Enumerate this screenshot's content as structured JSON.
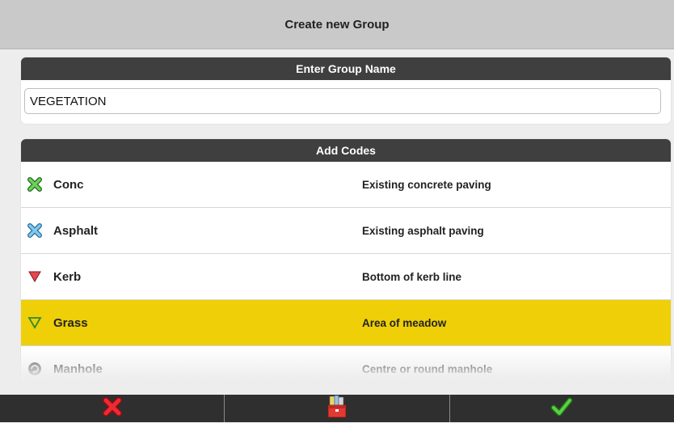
{
  "header": {
    "title": "Create new Group"
  },
  "name_section": {
    "title": "Enter Group Name",
    "value": "VEGETATION"
  },
  "codes_section": {
    "title": "Add Codes",
    "rows": [
      {
        "name": "Conc",
        "description": "Existing concrete paving",
        "icon": "green-x-point-icon",
        "selected": false
      },
      {
        "name": "Asphalt",
        "description": "Existing asphalt paving",
        "icon": "blue-x-point-icon",
        "selected": false
      },
      {
        "name": "Kerb",
        "description": "Bottom of kerb line",
        "icon": "red-triangle-line-icon",
        "selected": false
      },
      {
        "name": "Grass",
        "description": "Area of meadow",
        "icon": "green-triangle-outline-icon",
        "selected": true
      },
      {
        "name": "Manhole",
        "description": "Centre or round manhole",
        "icon": "grey-circle-arrow-icon",
        "selected": false
      }
    ]
  },
  "toolbar": {
    "cancel_icon": "red-x-cancel-icon",
    "library_icon": "code-library-toolbox-icon",
    "confirm_icon": "green-checkmark-icon"
  },
  "colors": {
    "selected_row": "#efcf08",
    "header_dark": "#3f3f3f",
    "title_bar": "#c9c9c9"
  }
}
